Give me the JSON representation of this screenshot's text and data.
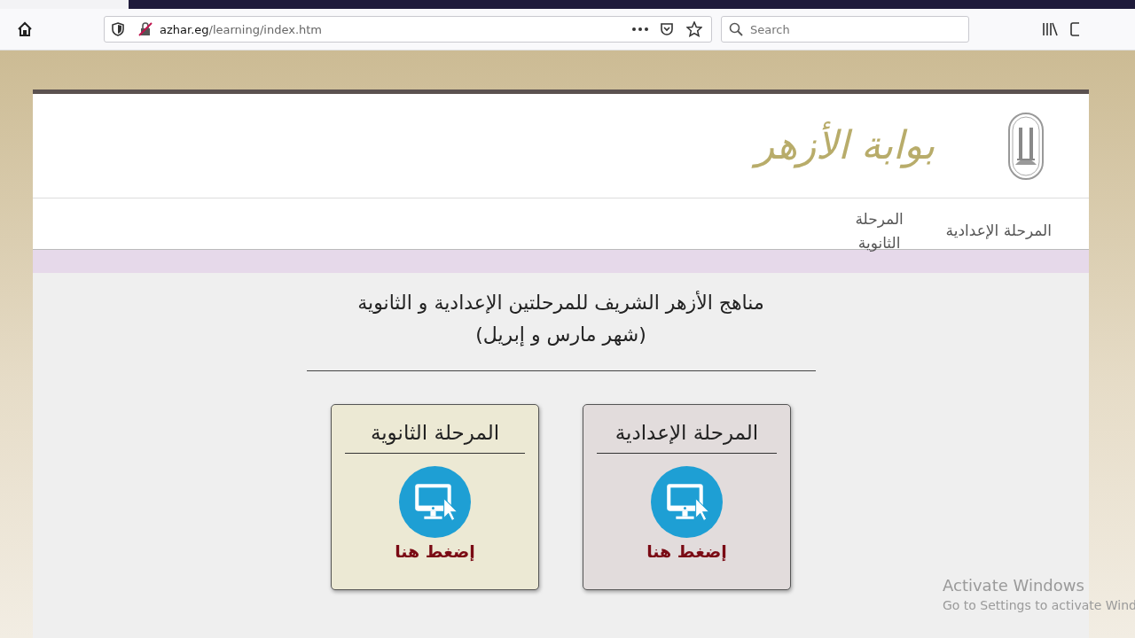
{
  "browser": {
    "url_host": "azhar.eg",
    "url_path": "/learning/index.htm",
    "search": {
      "placeholder": "Search"
    }
  },
  "header": {
    "logo_text": "بوابة الأزهر"
  },
  "nav": [
    {
      "label": "المرحلة الإعدادية"
    },
    {
      "label": "المرحلة الثانوية"
    }
  ],
  "intro": {
    "title": "مناهج الأزهر الشريف للمرحلتين الإعدادية و الثانوية",
    "subtitle": "(شهر مارس و إبريل)"
  },
  "cards": [
    {
      "title": "المرحلة الإعدادية",
      "action": "إضغط هنا",
      "color": "#e2dcdc"
    },
    {
      "title": "المرحلة الثانوية",
      "action": "إضغط هنا",
      "color": "#ece9d4"
    }
  ],
  "os_overlay": {
    "title": "Activate Windows",
    "subtitle": "Go to Settings to activate Wind"
  }
}
